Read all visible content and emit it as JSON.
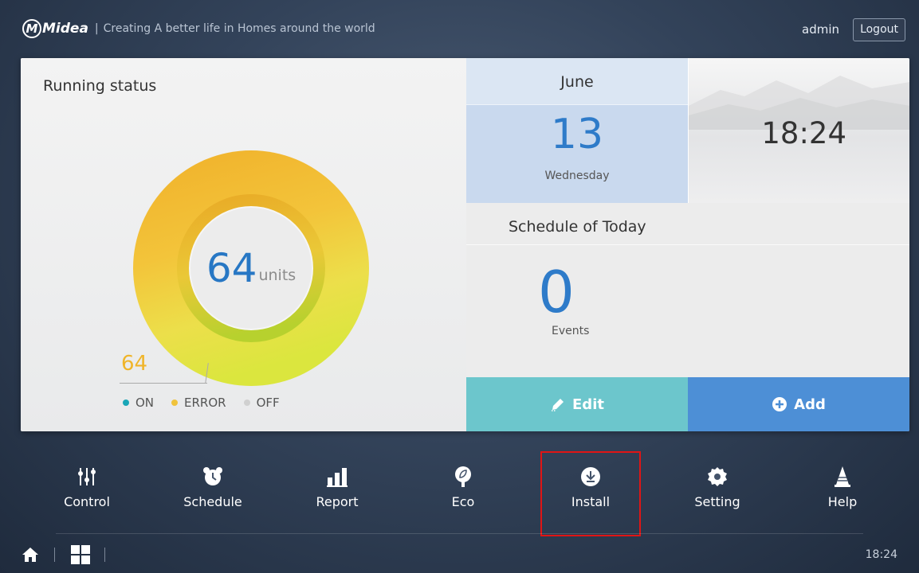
{
  "header": {
    "logo_text": "Midea",
    "slogan": "Creating A better life in Homes around the world",
    "user": "admin",
    "logout_label": "Logout"
  },
  "running_status": {
    "title": "Running status",
    "total_units": "64",
    "units_label": "units",
    "count_label": "64",
    "legend": [
      {
        "label": "ON",
        "color": "#1aa6b7"
      },
      {
        "label": "ERROR",
        "color": "#f0c33c"
      },
      {
        "label": "OFF",
        "color": "#d0d0d0"
      }
    ],
    "ring_colors": {
      "outer": "#f2b82c",
      "inner": "#e8d53f",
      "accent": "#b7d12e"
    }
  },
  "date": {
    "month": "June",
    "day": "13",
    "weekday": "Wednesday"
  },
  "clock": {
    "time": "18:24"
  },
  "schedule": {
    "title": "Schedule of Today",
    "events_count": "0",
    "events_label": "Events",
    "edit_label": "Edit",
    "add_label": "Add"
  },
  "nav": [
    {
      "label": "Control",
      "icon": "sliders-icon"
    },
    {
      "label": "Schedule",
      "icon": "alarm-clock-icon"
    },
    {
      "label": "Report",
      "icon": "bar-chart-icon"
    },
    {
      "label": "Eco",
      "icon": "leaf-icon"
    },
    {
      "label": "Install",
      "icon": "install-icon"
    },
    {
      "label": "Setting",
      "icon": "gear-icon"
    },
    {
      "label": "Help",
      "icon": "cone-icon"
    }
  ],
  "footer": {
    "time": "18:24"
  },
  "colors": {
    "accent_blue": "#2e7bc9",
    "edit_teal": "#6cc6cc",
    "add_blue": "#4d8fd6",
    "highlight_red": "#e01515"
  }
}
